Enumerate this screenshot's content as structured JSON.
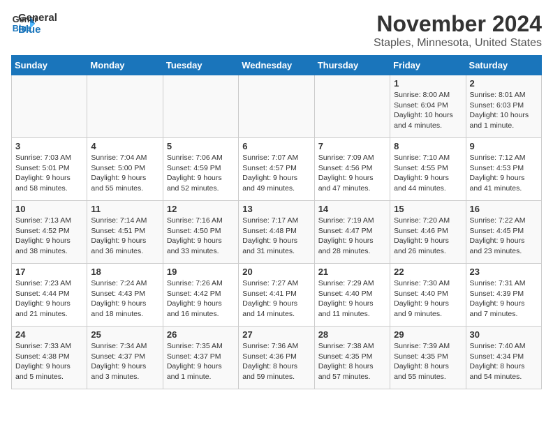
{
  "logo": {
    "line1": "General",
    "line2": "Blue"
  },
  "title": "November 2024",
  "subtitle": "Staples, Minnesota, United States",
  "days_of_week": [
    "Sunday",
    "Monday",
    "Tuesday",
    "Wednesday",
    "Thursday",
    "Friday",
    "Saturday"
  ],
  "weeks": [
    [
      {
        "day": "",
        "info": ""
      },
      {
        "day": "",
        "info": ""
      },
      {
        "day": "",
        "info": ""
      },
      {
        "day": "",
        "info": ""
      },
      {
        "day": "",
        "info": ""
      },
      {
        "day": "1",
        "info": "Sunrise: 8:00 AM\nSunset: 6:04 PM\nDaylight: 10 hours\nand 4 minutes."
      },
      {
        "day": "2",
        "info": "Sunrise: 8:01 AM\nSunset: 6:03 PM\nDaylight: 10 hours\nand 1 minute."
      }
    ],
    [
      {
        "day": "3",
        "info": "Sunrise: 7:03 AM\nSunset: 5:01 PM\nDaylight: 9 hours\nand 58 minutes."
      },
      {
        "day": "4",
        "info": "Sunrise: 7:04 AM\nSunset: 5:00 PM\nDaylight: 9 hours\nand 55 minutes."
      },
      {
        "day": "5",
        "info": "Sunrise: 7:06 AM\nSunset: 4:59 PM\nDaylight: 9 hours\nand 52 minutes."
      },
      {
        "day": "6",
        "info": "Sunrise: 7:07 AM\nSunset: 4:57 PM\nDaylight: 9 hours\nand 49 minutes."
      },
      {
        "day": "7",
        "info": "Sunrise: 7:09 AM\nSunset: 4:56 PM\nDaylight: 9 hours\nand 47 minutes."
      },
      {
        "day": "8",
        "info": "Sunrise: 7:10 AM\nSunset: 4:55 PM\nDaylight: 9 hours\nand 44 minutes."
      },
      {
        "day": "9",
        "info": "Sunrise: 7:12 AM\nSunset: 4:53 PM\nDaylight: 9 hours\nand 41 minutes."
      }
    ],
    [
      {
        "day": "10",
        "info": "Sunrise: 7:13 AM\nSunset: 4:52 PM\nDaylight: 9 hours\nand 38 minutes."
      },
      {
        "day": "11",
        "info": "Sunrise: 7:14 AM\nSunset: 4:51 PM\nDaylight: 9 hours\nand 36 minutes."
      },
      {
        "day": "12",
        "info": "Sunrise: 7:16 AM\nSunset: 4:50 PM\nDaylight: 9 hours\nand 33 minutes."
      },
      {
        "day": "13",
        "info": "Sunrise: 7:17 AM\nSunset: 4:48 PM\nDaylight: 9 hours\nand 31 minutes."
      },
      {
        "day": "14",
        "info": "Sunrise: 7:19 AM\nSunset: 4:47 PM\nDaylight: 9 hours\nand 28 minutes."
      },
      {
        "day": "15",
        "info": "Sunrise: 7:20 AM\nSunset: 4:46 PM\nDaylight: 9 hours\nand 26 minutes."
      },
      {
        "day": "16",
        "info": "Sunrise: 7:22 AM\nSunset: 4:45 PM\nDaylight: 9 hours\nand 23 minutes."
      }
    ],
    [
      {
        "day": "17",
        "info": "Sunrise: 7:23 AM\nSunset: 4:44 PM\nDaylight: 9 hours\nand 21 minutes."
      },
      {
        "day": "18",
        "info": "Sunrise: 7:24 AM\nSunset: 4:43 PM\nDaylight: 9 hours\nand 18 minutes."
      },
      {
        "day": "19",
        "info": "Sunrise: 7:26 AM\nSunset: 4:42 PM\nDaylight: 9 hours\nand 16 minutes."
      },
      {
        "day": "20",
        "info": "Sunrise: 7:27 AM\nSunset: 4:41 PM\nDaylight: 9 hours\nand 14 minutes."
      },
      {
        "day": "21",
        "info": "Sunrise: 7:29 AM\nSunset: 4:40 PM\nDaylight: 9 hours\nand 11 minutes."
      },
      {
        "day": "22",
        "info": "Sunrise: 7:30 AM\nSunset: 4:40 PM\nDaylight: 9 hours\nand 9 minutes."
      },
      {
        "day": "23",
        "info": "Sunrise: 7:31 AM\nSunset: 4:39 PM\nDaylight: 9 hours\nand 7 minutes."
      }
    ],
    [
      {
        "day": "24",
        "info": "Sunrise: 7:33 AM\nSunset: 4:38 PM\nDaylight: 9 hours\nand 5 minutes."
      },
      {
        "day": "25",
        "info": "Sunrise: 7:34 AM\nSunset: 4:37 PM\nDaylight: 9 hours\nand 3 minutes."
      },
      {
        "day": "26",
        "info": "Sunrise: 7:35 AM\nSunset: 4:37 PM\nDaylight: 9 hours\nand 1 minute."
      },
      {
        "day": "27",
        "info": "Sunrise: 7:36 AM\nSunset: 4:36 PM\nDaylight: 8 hours\nand 59 minutes."
      },
      {
        "day": "28",
        "info": "Sunrise: 7:38 AM\nSunset: 4:35 PM\nDaylight: 8 hours\nand 57 minutes."
      },
      {
        "day": "29",
        "info": "Sunrise: 7:39 AM\nSunset: 4:35 PM\nDaylight: 8 hours\nand 55 minutes."
      },
      {
        "day": "30",
        "info": "Sunrise: 7:40 AM\nSunset: 4:34 PM\nDaylight: 8 hours\nand 54 minutes."
      }
    ]
  ]
}
